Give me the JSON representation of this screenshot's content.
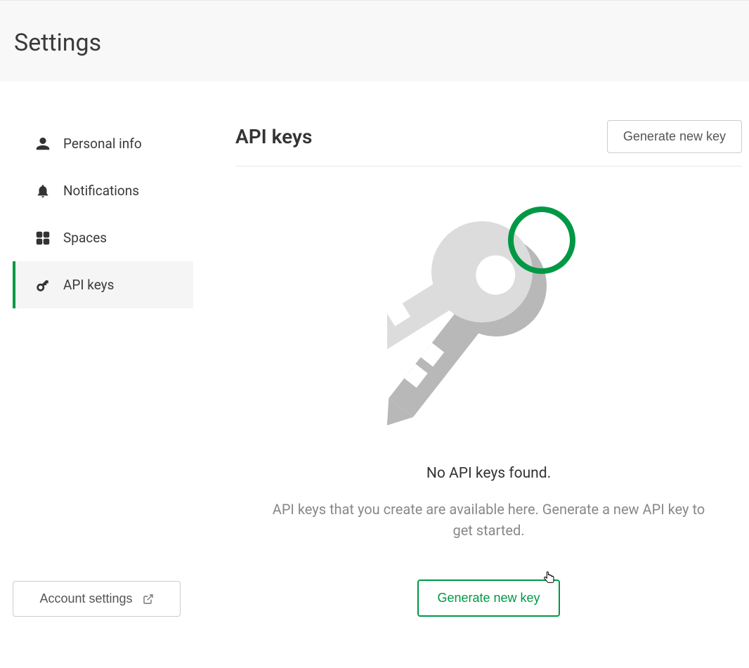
{
  "header": {
    "title": "Settings"
  },
  "sidebar": {
    "items": [
      {
        "label": "Personal info",
        "icon": "person",
        "active": false
      },
      {
        "label": "Notifications",
        "icon": "bell",
        "active": false
      },
      {
        "label": "Spaces",
        "icon": "grid",
        "active": false
      },
      {
        "label": "API keys",
        "icon": "key",
        "active": true
      }
    ],
    "account_settings_label": "Account settings"
  },
  "main": {
    "title": "API keys",
    "generate_button_top": "Generate new key",
    "empty_state": {
      "title": "No API keys found.",
      "description": "API keys that you create are available here. Generate a new API key to get started.",
      "generate_button": "Generate new key"
    }
  },
  "colors": {
    "accent": "#009845"
  }
}
